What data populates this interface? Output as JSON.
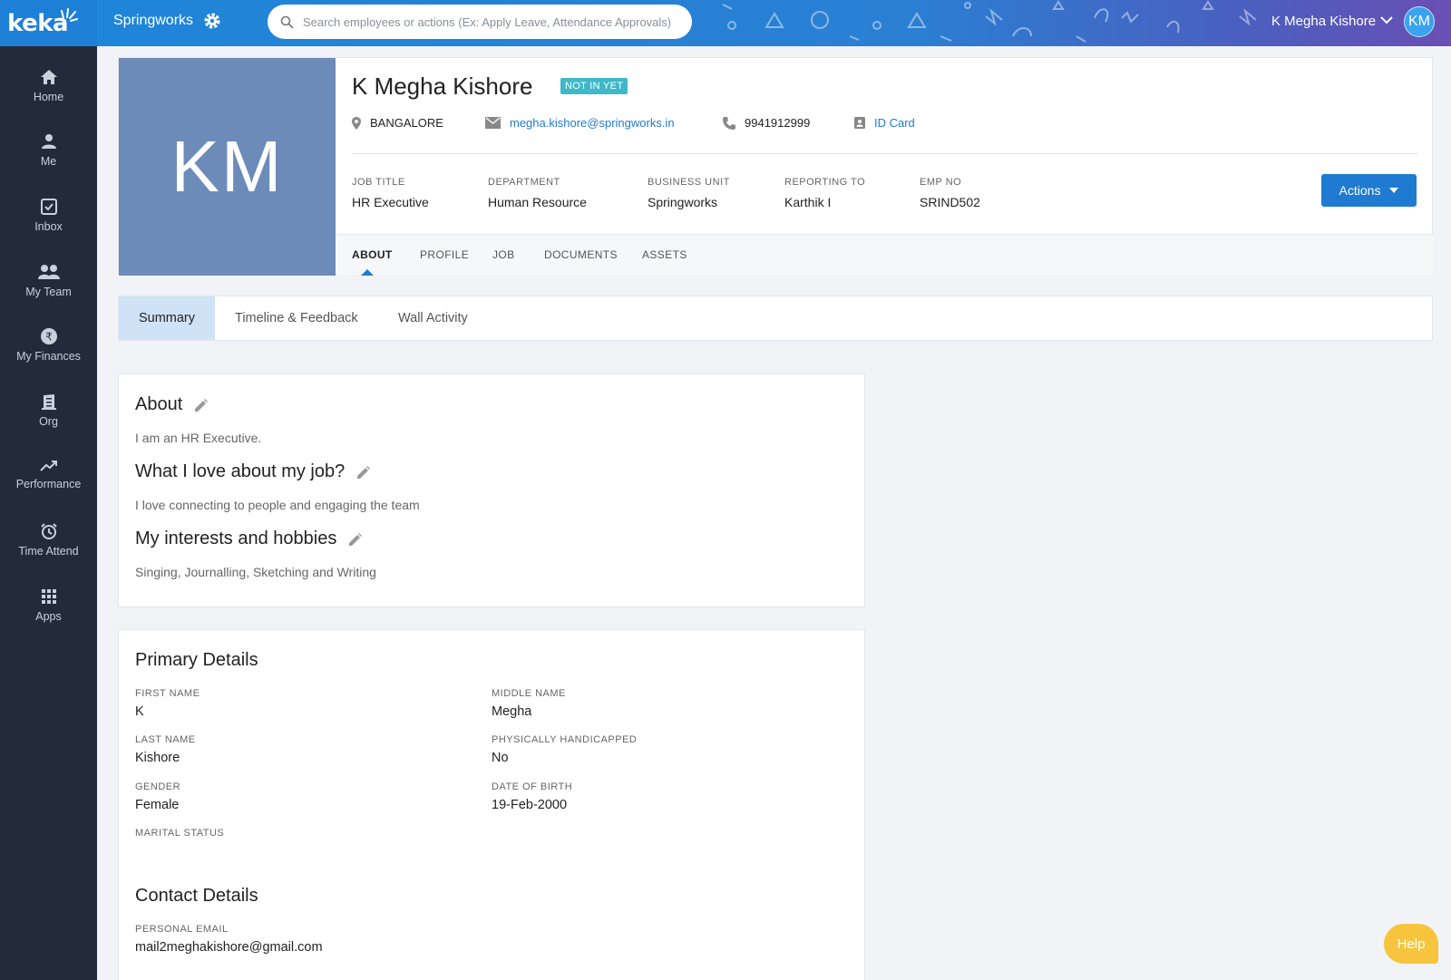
{
  "app": {
    "logo": "keka",
    "org_name": "Springworks"
  },
  "search": {
    "placeholder": "Search employees or actions (Ex: Apply Leave, Attendance Approvals)"
  },
  "user": {
    "name": "K Megha Kishore",
    "initials": "KM"
  },
  "sidebar": {
    "items": [
      {
        "label": "Home",
        "icon": "home-icon"
      },
      {
        "label": "Me",
        "icon": "person-icon"
      },
      {
        "label": "Inbox",
        "icon": "inbox-check-icon"
      },
      {
        "label": "My Team",
        "icon": "team-icon"
      },
      {
        "label": "My Finances",
        "icon": "rupee-icon"
      },
      {
        "label": "Org",
        "icon": "building-icon"
      },
      {
        "label": "Performance",
        "icon": "trend-icon"
      },
      {
        "label": "Time Attend",
        "icon": "clock-icon"
      },
      {
        "label": "Apps",
        "icon": "grid-icon"
      }
    ]
  },
  "profile": {
    "initials": "KM",
    "name": "K Megha Kishore",
    "status_badge": "NOT IN YET",
    "location": "BANGALORE",
    "email": "megha.kishore@springworks.in",
    "phone": "9941912999",
    "id_card": "ID Card",
    "meta": [
      {
        "label": "JOB TITLE",
        "value": "HR Executive"
      },
      {
        "label": "DEPARTMENT",
        "value": "Human Resource"
      },
      {
        "label": "BUSINESS UNIT",
        "value": "Springworks"
      },
      {
        "label": "REPORTING TO",
        "value": "Karthik I"
      },
      {
        "label": "EMP NO",
        "value": "SRIND502"
      }
    ],
    "actions_label": "Actions",
    "tabs": [
      "ABOUT",
      "PROFILE",
      "JOB",
      "DOCUMENTS",
      "ASSETS"
    ],
    "active_tab": "ABOUT"
  },
  "subtabs": [
    "Summary",
    "Timeline & Feedback",
    "Wall Activity"
  ],
  "about": {
    "sections": [
      {
        "title": "About",
        "text": "I am an HR Executive."
      },
      {
        "title": "What I love about my job?",
        "text": "I love connecting to people and engaging the team"
      },
      {
        "title": "My interests and hobbies",
        "text": "Singing, Journalling, Sketching and Writing"
      }
    ]
  },
  "primary_details": {
    "title": "Primary Details",
    "fields": [
      {
        "label": "FIRST NAME",
        "value": "K"
      },
      {
        "label": "MIDDLE NAME",
        "value": "Megha"
      },
      {
        "label": "LAST NAME",
        "value": "Kishore"
      },
      {
        "label": "PHYSICALLY HANDICAPPED",
        "value": "No"
      },
      {
        "label": "GENDER",
        "value": "Female"
      },
      {
        "label": "DATE OF BIRTH",
        "value": "19-Feb-2000"
      },
      {
        "label": "MARITAL STATUS",
        "value": ""
      }
    ]
  },
  "contact_details": {
    "title": "Contact Details",
    "fields": [
      {
        "label": "PERSONAL EMAIL",
        "value": "mail2meghakishore@gmail.com"
      }
    ]
  },
  "help": {
    "label": "Help"
  },
  "colors": {
    "primary": "#1f7bd1",
    "sidebar": "#232b3a",
    "badge": "#3fb8c9",
    "avatar": "#6d8bb9",
    "help": "#f7c53d"
  }
}
